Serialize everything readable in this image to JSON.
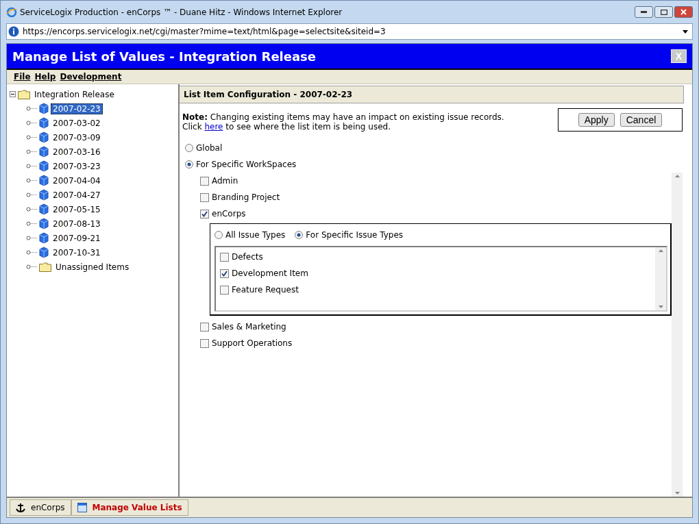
{
  "window": {
    "title": "ServiceLogix Production - enCorps ™ - Duane Hitz - Windows Internet Explorer"
  },
  "address_bar": {
    "url": "https://encorps.servicelogix.net/cgi/master?mime=text/html&page=selectsite&siteid=3"
  },
  "app": {
    "title": "Manage List of Values - Integration Release",
    "close": "X"
  },
  "menu": [
    "File",
    "Help",
    "Development"
  ],
  "tree": {
    "label": "Integration Release",
    "expanded": true,
    "children": [
      {
        "label": "2007-02-23",
        "kind": "release",
        "selected": true
      },
      {
        "label": "2007-03-02",
        "kind": "release",
        "selected": false
      },
      {
        "label": "2007-03-09",
        "kind": "release",
        "selected": false
      },
      {
        "label": "2007-03-16",
        "kind": "release",
        "selected": false
      },
      {
        "label": "2007-03-23",
        "kind": "release",
        "selected": false
      },
      {
        "label": "2007-04-04",
        "kind": "release",
        "selected": false
      },
      {
        "label": "2007-04-27",
        "kind": "release",
        "selected": false
      },
      {
        "label": "2007-05-15",
        "kind": "release",
        "selected": false
      },
      {
        "label": "2007-08-13",
        "kind": "release",
        "selected": false
      },
      {
        "label": "2007-09-21",
        "kind": "release",
        "selected": false
      },
      {
        "label": "2007-10-31",
        "kind": "release",
        "selected": false
      },
      {
        "label": "Unassigned Items",
        "kind": "folder",
        "selected": false
      }
    ]
  },
  "panel": {
    "title": "List Item Configuration - 2007-02-23",
    "note": "**Note:** Changing existing items may have an impact on existing issue records.",
    "link_prefix": "Click",
    "link": "here",
    "link_suffix": "to see where the list item is being used.",
    "buttons": [
      "Apply",
      "Cancel"
    ],
    "scope": [
      {
        "label": "Global",
        "selected": false
      },
      {
        "label": "For Specific WorkSpaces",
        "selected": true
      }
    ],
    "workspaces": [
      {
        "label": "Admin",
        "checked": false
      },
      {
        "label": "Branding Project",
        "checked": false
      },
      {
        "label": "enCorps",
        "checked": true,
        "issue_scope": [
          {
            "label": "All Issue Types",
            "selected": false
          },
          {
            "label": "For Specific Issue Types",
            "selected": true
          }
        ],
        "issue_types": [
          {
            "label": "Defects",
            "checked": false
          },
          {
            "label": "Development Item",
            "checked": true
          },
          {
            "label": "Feature Request",
            "checked": false
          }
        ]
      },
      {
        "label": "Sales & Marketing",
        "checked": false
      },
      {
        "label": "Support Operations",
        "checked": false
      }
    ]
  },
  "taskbar": [
    {
      "label": "enCorps",
      "selected": false
    },
    {
      "label": "Manage Value Lists",
      "selected": true
    }
  ]
}
